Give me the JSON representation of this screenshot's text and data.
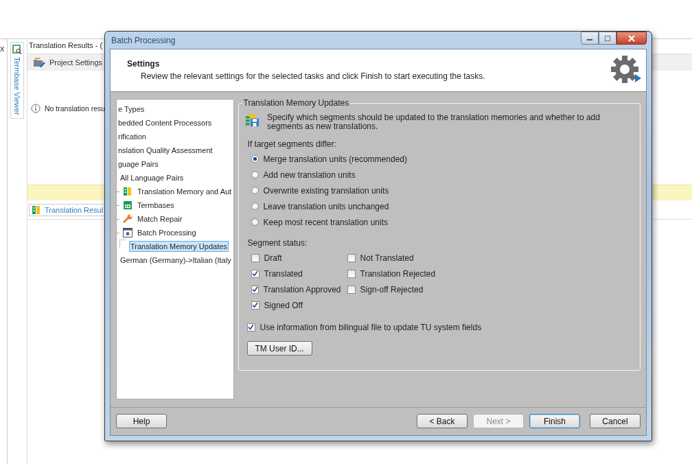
{
  "background": {
    "close_glyph": "x",
    "side_tab": "Termbase Viewer",
    "panel_title": "Translation Results - (",
    "toolbar_button": "Project Settings",
    "message": "No translation resu",
    "bottom_tab": "Translation Resul"
  },
  "dialog": {
    "title": "Batch Processing",
    "header": {
      "title": "Settings",
      "subtitle": "Review the relevant settings for the selected tasks and click Finish to start executing the tasks."
    },
    "tree": [
      {
        "label": "e Types",
        "selected": false
      },
      {
        "label": "bedded Content Processors",
        "selected": false
      },
      {
        "label": "rification",
        "selected": false
      },
      {
        "label": "nslation Quality Assessment",
        "selected": false
      },
      {
        "label": "guage Pairs",
        "selected": false,
        "children": [
          {
            "label": "All Language Pairs",
            "selected": false,
            "children": [
              {
                "label": "Translation Memory and Aut",
                "kind": "memory",
                "selected": false
              },
              {
                "label": "Termbases",
                "kind": "termbase",
                "selected": false
              },
              {
                "label": "Match Repair",
                "kind": "wrench",
                "selected": false
              },
              {
                "label": "Batch Processing",
                "kind": "batch",
                "selected": false,
                "children": [
                  {
                    "label": "Translation Memory Updates",
                    "selected": true
                  }
                ]
              }
            ]
          },
          {
            "label": "German (Germany)->Italian (Italy",
            "selected": false
          }
        ]
      }
    ],
    "group": {
      "title": "Translation Memory Updates",
      "description": "Specify which segments should be updated to the translation memories and whether to add segments as new translations.",
      "radio_label": "If target segments differ:",
      "radios": [
        {
          "label": "Merge translation units (recommended)",
          "selected": true
        },
        {
          "label": "Add new translation units",
          "selected": false
        },
        {
          "label": "Overwrite existing translation units",
          "selected": false
        },
        {
          "label": "Leave translation units unchanged",
          "selected": false
        },
        {
          "label": "Keep most recent translation units",
          "selected": false
        }
      ],
      "status_label": "Segment status:",
      "status_columns": [
        [
          {
            "label": "Draft",
            "checked": false
          },
          {
            "label": "Translated",
            "checked": true
          },
          {
            "label": "Translation Approved",
            "checked": true
          },
          {
            "label": "Signed Off",
            "checked": true
          }
        ],
        [
          {
            "label": "Not Translated",
            "checked": false
          },
          {
            "label": "Translation Rejected",
            "checked": false
          },
          {
            "label": "Sign-off Rejected",
            "checked": false
          }
        ]
      ],
      "use_info": {
        "label": "Use information from bilingual file to update TU system fields",
        "checked": true
      },
      "user_id_button": "TM User ID..."
    },
    "buttons": [
      {
        "label": "Help",
        "kind": "help",
        "disabled": false,
        "default": false
      },
      {
        "label": "< Back",
        "kind": "nav",
        "disabled": false,
        "default": false
      },
      {
        "label": "Next >",
        "kind": "nav",
        "disabled": true,
        "default": false
      },
      {
        "label": "Finish",
        "kind": "nav",
        "disabled": false,
        "default": true
      },
      {
        "label": "Cancel",
        "kind": "nav",
        "disabled": false,
        "default": false
      }
    ]
  }
}
